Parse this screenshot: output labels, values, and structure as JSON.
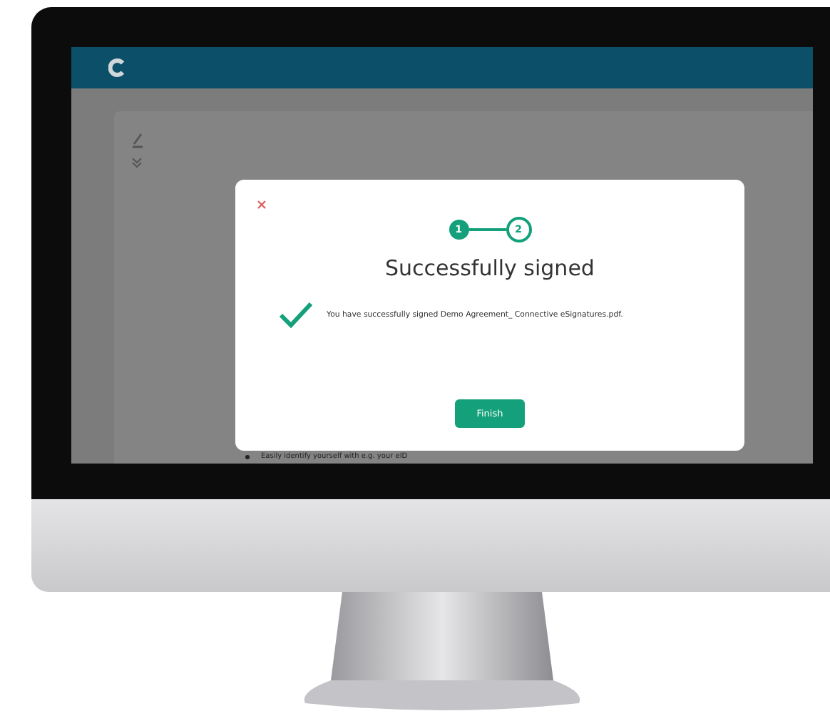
{
  "dialog": {
    "steps": [
      {
        "label": "1",
        "completed": true
      },
      {
        "label": "2",
        "completed": false
      }
    ],
    "title": "Successfully signed",
    "message": "You have successfully signed Demo Agreement_ Connective eSignatures.pdf.",
    "button": "Finish"
  },
  "background_text": "Easily identify yourself with e.g. your eID"
}
